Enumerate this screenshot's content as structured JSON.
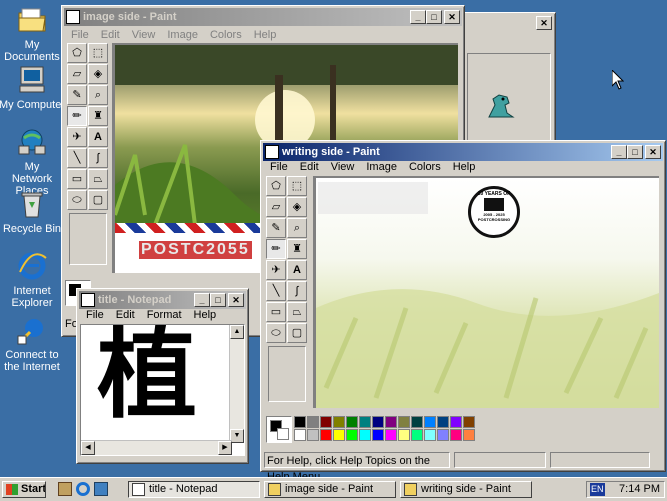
{
  "desktop": {
    "icons": [
      {
        "label": "My Documents",
        "icon": "folder-icon"
      },
      {
        "label": "My Computer",
        "icon": "computer-icon"
      },
      {
        "label": "My Network Places",
        "icon": "network-icon"
      },
      {
        "label": "Recycle Bin",
        "icon": "recycle-bin-icon"
      },
      {
        "label": "Internet Explorer",
        "icon": "internet-explorer-icon"
      },
      {
        "label": "Connect to the Internet",
        "icon": "connect-internet-icon"
      }
    ]
  },
  "windows": {
    "image_side": {
      "title": "image side - Paint",
      "menu": [
        "File",
        "Edit",
        "View",
        "Image",
        "Colors",
        "Help"
      ],
      "stamp_text": "POSTC2055"
    },
    "writing_side": {
      "title": "writing side - Paint",
      "menu": [
        "File",
        "Edit",
        "View",
        "Image",
        "Colors",
        "Help"
      ],
      "status": "For Help, click Help Topics on the Help Menu.",
      "seal": {
        "line1": "20 YEARS OF",
        "line2": "POSTCROSSING",
        "years": "2005 - 2025"
      }
    },
    "notepad": {
      "title": "title - Notepad",
      "menu": [
        "File",
        "Edit",
        "Format",
        "Help"
      ],
      "content": "植"
    },
    "bg_window": {
      "status_prefix": "For"
    }
  },
  "palette": {
    "top": [
      "#000000",
      "#808080",
      "#800000",
      "#808000",
      "#008000",
      "#008080",
      "#000080",
      "#800080",
      "#808040",
      "#004040",
      "#0080ff",
      "#004080",
      "#8000ff",
      "#804000"
    ],
    "bottom": [
      "#ffffff",
      "#c0c0c0",
      "#ff0000",
      "#ffff00",
      "#00ff00",
      "#00ffff",
      "#0000ff",
      "#ff00ff",
      "#ffff80",
      "#00ff80",
      "#80ffff",
      "#8080ff",
      "#ff0080",
      "#ff8040"
    ]
  },
  "taskbar": {
    "start_label": "Start",
    "buttons": [
      {
        "label": "title - Notepad",
        "icon": "notepad-icon"
      },
      {
        "label": "image side - Paint",
        "icon": "paint-icon"
      },
      {
        "label": "writing side - Paint",
        "icon": "paint-icon"
      }
    ],
    "lang": "EN",
    "clock": "7:14 PM"
  }
}
